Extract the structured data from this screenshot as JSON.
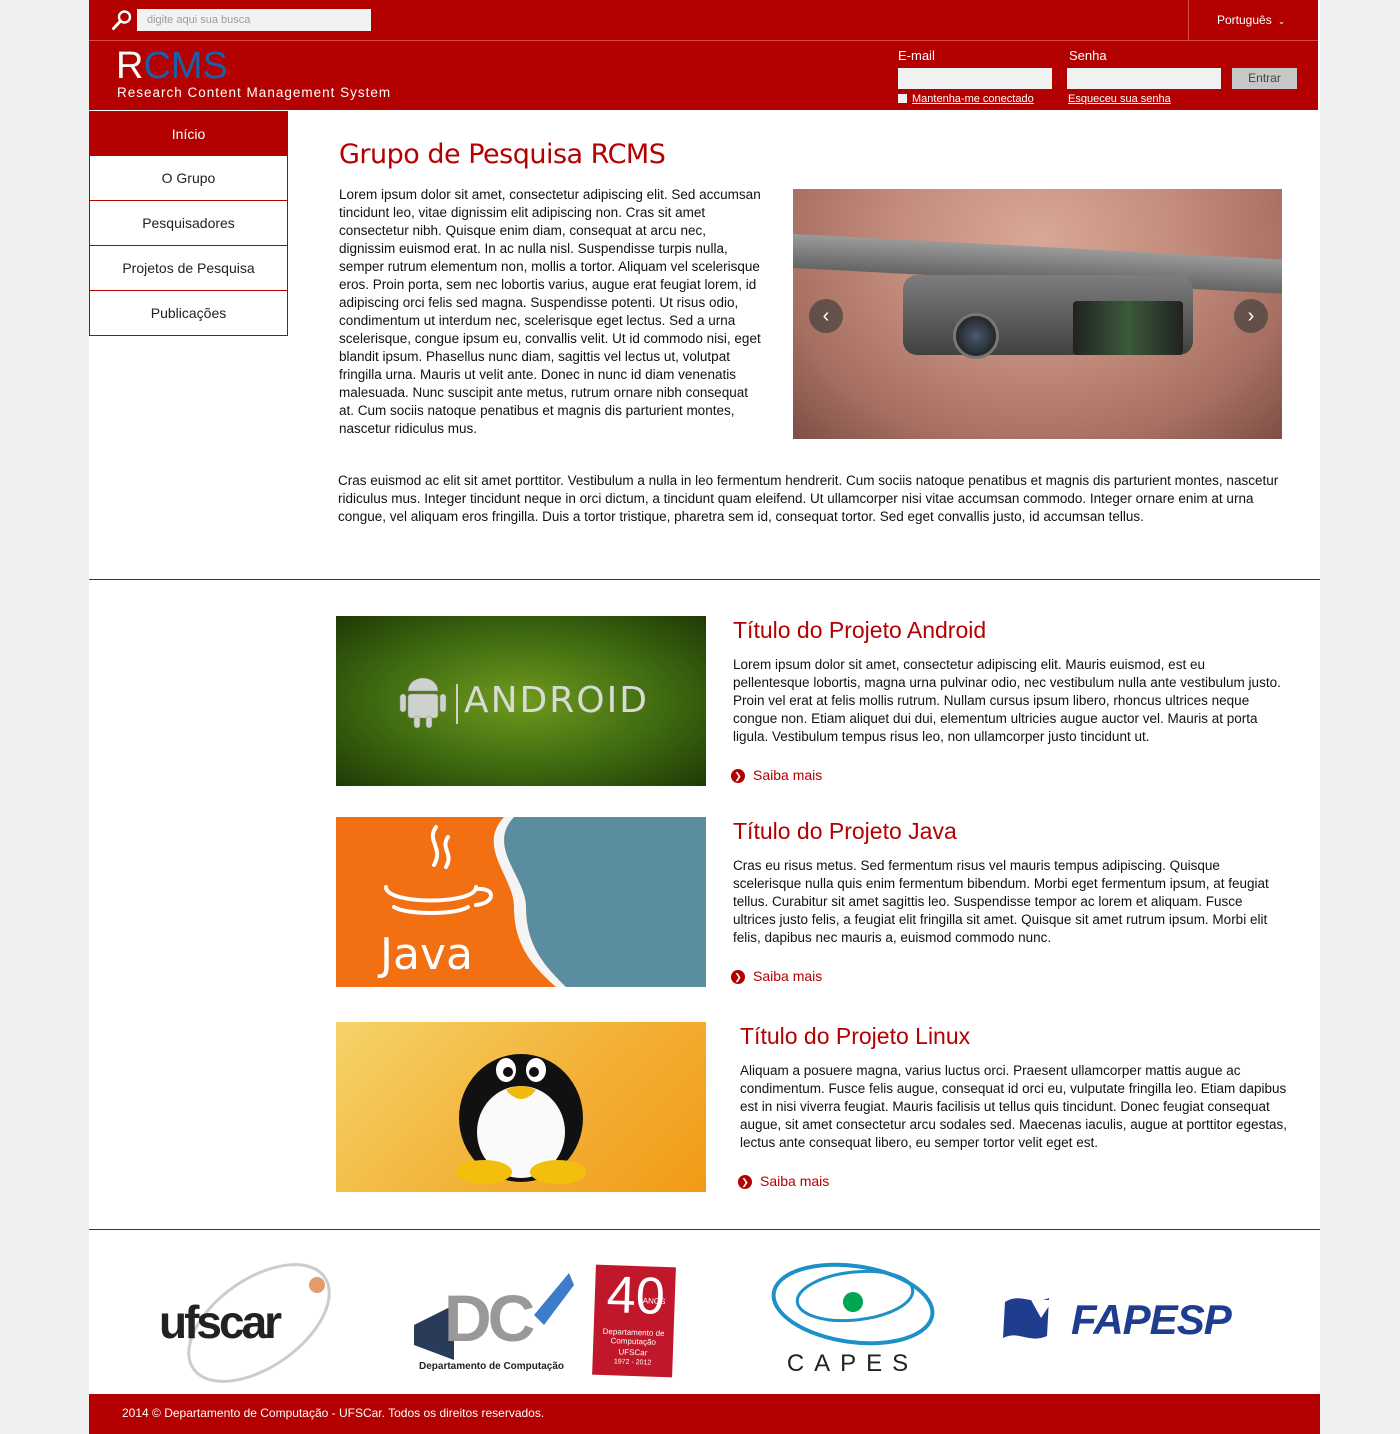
{
  "topbar": {
    "search_placeholder": "digite aqui sua busca",
    "language": "Português"
  },
  "header": {
    "logo_r": "R",
    "logo_cms": "CMS",
    "tagline": "Research Content Management System",
    "email_label": "E-mail",
    "password_label": "Senha",
    "enter_button": "Entrar",
    "keep_connected": "Mantenha-me conectado",
    "forgot_password": "Esqueceu sua senha"
  },
  "sidebar": {
    "items": [
      {
        "label": "Início"
      },
      {
        "label": "O Grupo"
      },
      {
        "label": "Pesquisadores"
      },
      {
        "label": "Projetos de Pesquisa"
      },
      {
        "label": "Publicações"
      }
    ]
  },
  "main": {
    "title": "Grupo de Pesquisa RCMS",
    "intro": "Lorem ipsum dolor sit amet, consectetur adipiscing elit. Sed accumsan tincidunt leo, vitae dignissim elit adipiscing non. Cras sit amet consectetur nibh. Quisque enim diam, consequat at arcu nec, dignissim euismod erat. In ac nulla nisl. Suspendisse turpis nulla, semper rutrum elementum non, mollis a tortor. Aliquam vel scelerisque eros. Proin porta, sem nec lobortis varius, augue erat feugiat lorem, id adipiscing orci felis sed magna. Suspendisse potenti. Ut risus odio, condimentum ut interdum nec, scelerisque eget lectus. Sed a urna scelerisque, congue ipsum eu, convallis velit. Ut id commodo nisi, eget blandit ipsum. Phasellus nunc diam, sagittis vel lectus ut, volutpat fringilla urna. Mauris ut velit ante. Donec in nunc id diam venenatis malesuada. Nunc suscipit ante metus, rutrum ornare nibh consequat at. Cum sociis natoque penatibus et magnis dis parturient montes, nascetur ridiculus mus.",
    "paragraph2": "Cras euismod ac elit sit amet porttitor. Vestibulum a nulla in leo fermentum hendrerit. Cum sociis natoque penatibus et magnis dis parturient montes, nascetur ridiculus mus. Integer tincidunt neque in orci dictum, a tincidunt quam eleifend. Ut ullamcorper nisi vitae accumsan commodo. Integer ornare enim at urna congue, vel aliquam eros fringilla. Duis a tortor tristique, pharetra sem id, consequat tortor. Sed eget convallis justo, id accumsan tellus."
  },
  "projects": [
    {
      "image_text": "ANDROID",
      "title": "Título do Projeto Android",
      "text": "Lorem ipsum dolor sit amet, consectetur adipiscing elit. Mauris euismod, est eu pellentesque lobortis, magna urna pulvinar odio, nec vestibulum nulla ante vestibulum justo. Proin vel erat at felis mollis rutrum. Nullam cursus ipsum libero, rhoncus ultrices neque congue non. Etiam aliquet dui dui, elementum ultricies augue auctor vel. Mauris at porta ligula. Vestibulum tempus risus leo, non ullamcorper justo tincidunt ut.",
      "more": "Saiba mais"
    },
    {
      "image_text": "Java",
      "title": "Título do Projeto Java",
      "text": "Cras eu risus metus. Sed fermentum risus vel mauris tempus adipiscing. Quisque scelerisque nulla quis enim fermentum bibendum. Morbi eget fermentum ipsum, at feugiat tellus. Curabitur sit amet sagittis leo. Suspendisse tempor ac lorem et aliquam. Fusce ultrices justo felis, a feugiat elit fringilla sit amet. Quisque sit amet rutrum ipsum. Morbi elit felis, dapibus nec mauris a, euismod commodo nunc.",
      "more": "Saiba mais"
    },
    {
      "title": "Título do Projeto Linux",
      "text": "Aliquam a posuere magna, varius luctus orci. Praesent ullamcorper mattis augue ac condimentum. Fusce felis augue, consequat id orci eu, vulputate fringilla leo. Etiam dapibus est in nisi viverra feugiat. Mauris facilisis ut tellus quis tincidunt. Donec feugiat consequat augue, sit amet consectetur arcu sodales sed. Maecenas iaculis, augue at porttitor egestas, lectus ante consequat libero, eu semper tortor velit eget est.",
      "more": "Saiba mais"
    }
  ],
  "partners": {
    "ufscar": "ufscar",
    "dc": "DC",
    "dc_caption": "Departamento de Computação",
    "dc40_number": "40",
    "dc40_anos": "ANOS",
    "dc40_caption": "Departamento de Computação",
    "dc40_ufscar": "UFSCar",
    "dc40_years": "1972 - 2012",
    "capes": "CAPES",
    "fapesp": "FAPESP"
  },
  "colors": {
    "brand_red": "#b30000",
    "logo_blue": "#1d5fa8"
  },
  "footer": {
    "text": "2014 © Departamento de Computação - UFSCar. Todos os direitos reservados."
  }
}
